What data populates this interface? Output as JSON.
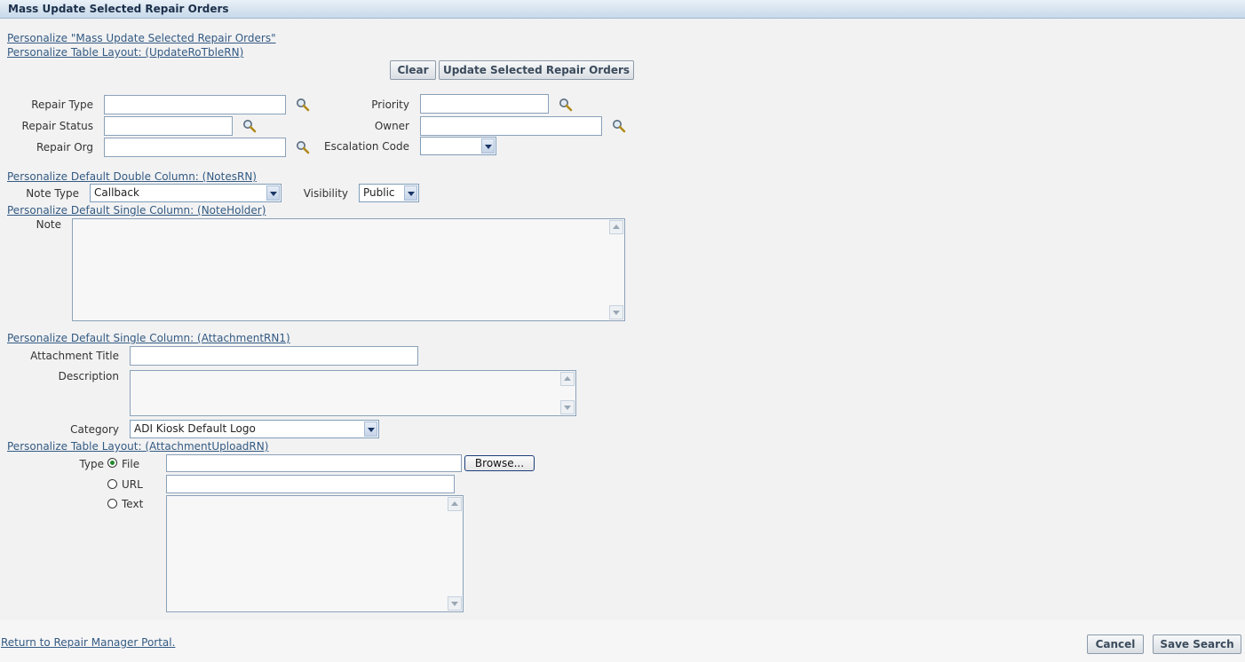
{
  "page": {
    "title": "Mass Update Selected Repair Orders"
  },
  "personalize_links": {
    "page": "Personalize \"Mass Update Selected Repair Orders\"",
    "table_layout_update": "Personalize Table Layout: (UpdateRoTbleRN)",
    "notes_double_column": "Personalize Default Double Column: (NotesRN)",
    "note_holder": "Personalize Default Single Column: (NoteHolder)",
    "attachment_single_column": "Personalize Default Single Column: (AttachmentRN1)",
    "attachment_upload_table": "Personalize Table Layout: (AttachmentUploadRN)"
  },
  "actions": {
    "clear": "Clear",
    "update_selected": "Update Selected Repair Orders"
  },
  "repair_fields": {
    "repair_type": {
      "label": "Repair Type",
      "value": ""
    },
    "repair_status": {
      "label": "Repair Status",
      "value": ""
    },
    "repair_org": {
      "label": "Repair Org",
      "value": ""
    },
    "priority": {
      "label": "Priority",
      "value": ""
    },
    "owner": {
      "label": "Owner",
      "value": ""
    },
    "escalation_code": {
      "label": "Escalation Code",
      "value": ""
    }
  },
  "notes": {
    "note_type": {
      "label": "Note Type",
      "value": "Callback"
    },
    "visibility": {
      "label": "Visibility",
      "value": "Public"
    },
    "note": {
      "label": "Note",
      "value": ""
    }
  },
  "attachment": {
    "title": {
      "label": "Attachment Title",
      "value": ""
    },
    "description": {
      "label": "Description",
      "value": ""
    },
    "category": {
      "label": "Category",
      "value": "ADI Kiosk Default Logo"
    },
    "type_label": "Type",
    "options": {
      "file": "File",
      "url": "URL",
      "text": "Text"
    },
    "selected_type": "File",
    "browse": "Browse..."
  },
  "footer": {
    "return_link": "Return to Repair Manager Portal.",
    "cancel": "Cancel",
    "save_search": "Save Search"
  },
  "colors": {
    "link": "#335a82",
    "title_bar": "#c7d9ea",
    "content_bg": "#f2f2f3",
    "radio_selected": "#1e8a2a"
  },
  "icons": {
    "lookup": "search-icon"
  }
}
